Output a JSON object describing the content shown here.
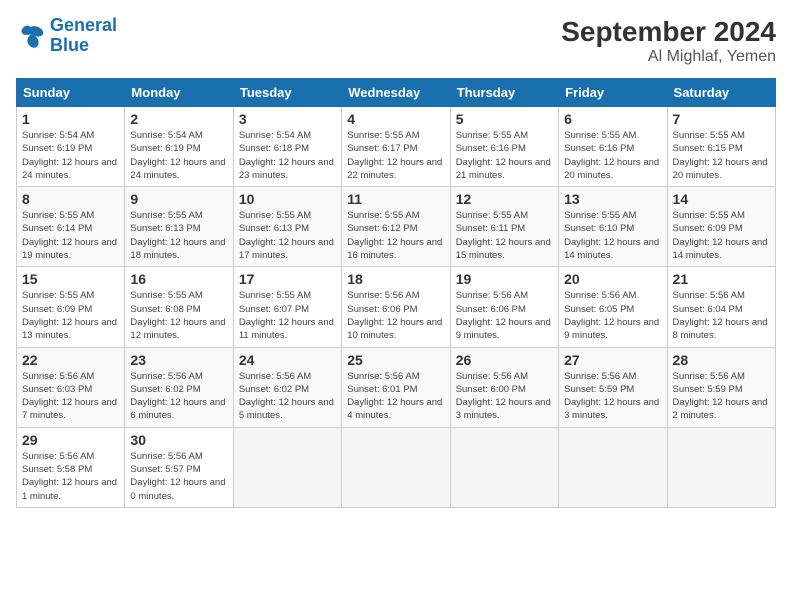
{
  "header": {
    "logo_line1": "General",
    "logo_line2": "Blue",
    "month": "September 2024",
    "location": "Al Mighlaf, Yemen"
  },
  "days_of_week": [
    "Sunday",
    "Monday",
    "Tuesday",
    "Wednesday",
    "Thursday",
    "Friday",
    "Saturday"
  ],
  "weeks": [
    [
      {
        "num": "1",
        "sunrise": "Sunrise: 5:54 AM",
        "sunset": "Sunset: 6:19 PM",
        "daylight": "Daylight: 12 hours and 24 minutes."
      },
      {
        "num": "2",
        "sunrise": "Sunrise: 5:54 AM",
        "sunset": "Sunset: 6:19 PM",
        "daylight": "Daylight: 12 hours and 24 minutes."
      },
      {
        "num": "3",
        "sunrise": "Sunrise: 5:54 AM",
        "sunset": "Sunset: 6:18 PM",
        "daylight": "Daylight: 12 hours and 23 minutes."
      },
      {
        "num": "4",
        "sunrise": "Sunrise: 5:55 AM",
        "sunset": "Sunset: 6:17 PM",
        "daylight": "Daylight: 12 hours and 22 minutes."
      },
      {
        "num": "5",
        "sunrise": "Sunrise: 5:55 AM",
        "sunset": "Sunset: 6:16 PM",
        "daylight": "Daylight: 12 hours and 21 minutes."
      },
      {
        "num": "6",
        "sunrise": "Sunrise: 5:55 AM",
        "sunset": "Sunset: 6:16 PM",
        "daylight": "Daylight: 12 hours and 20 minutes."
      },
      {
        "num": "7",
        "sunrise": "Sunrise: 5:55 AM",
        "sunset": "Sunset: 6:15 PM",
        "daylight": "Daylight: 12 hours and 20 minutes."
      }
    ],
    [
      {
        "num": "8",
        "sunrise": "Sunrise: 5:55 AM",
        "sunset": "Sunset: 6:14 PM",
        "daylight": "Daylight: 12 hours and 19 minutes."
      },
      {
        "num": "9",
        "sunrise": "Sunrise: 5:55 AM",
        "sunset": "Sunset: 6:13 PM",
        "daylight": "Daylight: 12 hours and 18 minutes."
      },
      {
        "num": "10",
        "sunrise": "Sunrise: 5:55 AM",
        "sunset": "Sunset: 6:13 PM",
        "daylight": "Daylight: 12 hours and 17 minutes."
      },
      {
        "num": "11",
        "sunrise": "Sunrise: 5:55 AM",
        "sunset": "Sunset: 6:12 PM",
        "daylight": "Daylight: 12 hours and 16 minutes."
      },
      {
        "num": "12",
        "sunrise": "Sunrise: 5:55 AM",
        "sunset": "Sunset: 6:11 PM",
        "daylight": "Daylight: 12 hours and 15 minutes."
      },
      {
        "num": "13",
        "sunrise": "Sunrise: 5:55 AM",
        "sunset": "Sunset: 6:10 PM",
        "daylight": "Daylight: 12 hours and 14 minutes."
      },
      {
        "num": "14",
        "sunrise": "Sunrise: 5:55 AM",
        "sunset": "Sunset: 6:09 PM",
        "daylight": "Daylight: 12 hours and 14 minutes."
      }
    ],
    [
      {
        "num": "15",
        "sunrise": "Sunrise: 5:55 AM",
        "sunset": "Sunset: 6:09 PM",
        "daylight": "Daylight: 12 hours and 13 minutes."
      },
      {
        "num": "16",
        "sunrise": "Sunrise: 5:55 AM",
        "sunset": "Sunset: 6:08 PM",
        "daylight": "Daylight: 12 hours and 12 minutes."
      },
      {
        "num": "17",
        "sunrise": "Sunrise: 5:55 AM",
        "sunset": "Sunset: 6:07 PM",
        "daylight": "Daylight: 12 hours and 11 minutes."
      },
      {
        "num": "18",
        "sunrise": "Sunrise: 5:56 AM",
        "sunset": "Sunset: 6:06 PM",
        "daylight": "Daylight: 12 hours and 10 minutes."
      },
      {
        "num": "19",
        "sunrise": "Sunrise: 5:56 AM",
        "sunset": "Sunset: 6:06 PM",
        "daylight": "Daylight: 12 hours and 9 minutes."
      },
      {
        "num": "20",
        "sunrise": "Sunrise: 5:56 AM",
        "sunset": "Sunset: 6:05 PM",
        "daylight": "Daylight: 12 hours and 9 minutes."
      },
      {
        "num": "21",
        "sunrise": "Sunrise: 5:56 AM",
        "sunset": "Sunset: 6:04 PM",
        "daylight": "Daylight: 12 hours and 8 minutes."
      }
    ],
    [
      {
        "num": "22",
        "sunrise": "Sunrise: 5:56 AM",
        "sunset": "Sunset: 6:03 PM",
        "daylight": "Daylight: 12 hours and 7 minutes."
      },
      {
        "num": "23",
        "sunrise": "Sunrise: 5:56 AM",
        "sunset": "Sunset: 6:02 PM",
        "daylight": "Daylight: 12 hours and 6 minutes."
      },
      {
        "num": "24",
        "sunrise": "Sunrise: 5:56 AM",
        "sunset": "Sunset: 6:02 PM",
        "daylight": "Daylight: 12 hours and 5 minutes."
      },
      {
        "num": "25",
        "sunrise": "Sunrise: 5:56 AM",
        "sunset": "Sunset: 6:01 PM",
        "daylight": "Daylight: 12 hours and 4 minutes."
      },
      {
        "num": "26",
        "sunrise": "Sunrise: 5:56 AM",
        "sunset": "Sunset: 6:00 PM",
        "daylight": "Daylight: 12 hours and 3 minutes."
      },
      {
        "num": "27",
        "sunrise": "Sunrise: 5:56 AM",
        "sunset": "Sunset: 5:59 PM",
        "daylight": "Daylight: 12 hours and 3 minutes."
      },
      {
        "num": "28",
        "sunrise": "Sunrise: 5:56 AM",
        "sunset": "Sunset: 5:59 PM",
        "daylight": "Daylight: 12 hours and 2 minutes."
      }
    ],
    [
      {
        "num": "29",
        "sunrise": "Sunrise: 5:56 AM",
        "sunset": "Sunset: 5:58 PM",
        "daylight": "Daylight: 12 hours and 1 minute."
      },
      {
        "num": "30",
        "sunrise": "Sunrise: 5:56 AM",
        "sunset": "Sunset: 5:57 PM",
        "daylight": "Daylight: 12 hours and 0 minutes."
      },
      null,
      null,
      null,
      null,
      null
    ]
  ]
}
